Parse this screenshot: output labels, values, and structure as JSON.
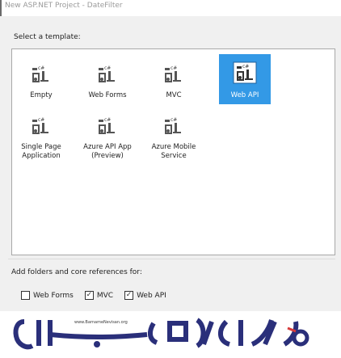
{
  "window": {
    "title": "New ASP.NET Project - DateFilter"
  },
  "templates_section": {
    "label": "Select a template:",
    "icon": "csharp-project-icon",
    "items": [
      {
        "label": "Empty",
        "selected": false
      },
      {
        "label": "Web Forms",
        "selected": false
      },
      {
        "label": "MVC",
        "selected": false
      },
      {
        "label": "Web API",
        "selected": true
      },
      {
        "label": "Single Page\nApplication",
        "selected": false
      },
      {
        "label": "Azure API App\n(Preview)",
        "selected": false
      },
      {
        "label": "Azure Mobile\nService",
        "selected": false
      }
    ]
  },
  "folders_section": {
    "label": "Add folders and core references for:",
    "options": [
      {
        "label": "Web Forms",
        "checked": false
      },
      {
        "label": "MVC",
        "checked": true
      },
      {
        "label": "Web API",
        "checked": true
      }
    ]
  },
  "watermark": {
    "text": "www.BarnameNevisan.org"
  },
  "colors": {
    "selection": "#3399e6",
    "panel": "#f0f0f0",
    "border": "#a8a8a8"
  }
}
